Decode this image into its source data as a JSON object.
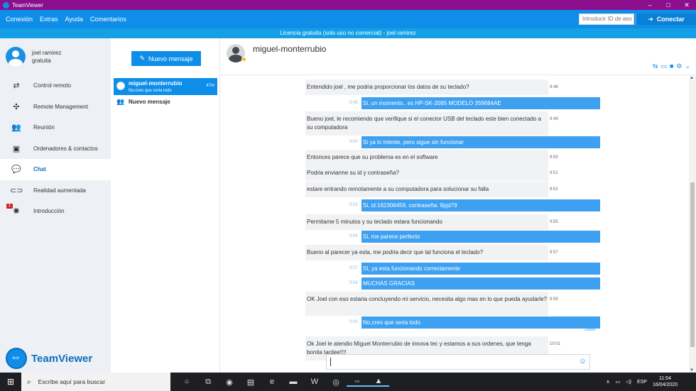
{
  "window": {
    "title": "TeamViewer"
  },
  "menu": [
    "Conexión",
    "Extras",
    "Ayuda",
    "Comentarios"
  ],
  "topbar": {
    "id_placeholder": "Introducir ID de aso",
    "connect_label": "Conectar"
  },
  "license": "Licencia gratuita (solo uso no comercial) - joel ramirez",
  "profile": {
    "name": "joel ramirez",
    "plan": "gratuita"
  },
  "nav": [
    {
      "label": "Control remoto",
      "icon": "arrows-icon"
    },
    {
      "label": "Remote Management",
      "icon": "crosshair-icon"
    },
    {
      "label": "Reunión",
      "icon": "people-icon"
    },
    {
      "label": "Ordenadores & contactos",
      "icon": "contacts-icon"
    },
    {
      "label": "Chat",
      "icon": "chat-icon",
      "active": true
    },
    {
      "label": "Realidad aumentada",
      "icon": "ar-glasses-icon"
    },
    {
      "label": "Introducción",
      "icon": "lightbulb-icon",
      "badge": "1"
    }
  ],
  "brand": "TeamViewer",
  "conversations": {
    "new_message_button": "Nuevo mensaje",
    "active": {
      "name": "miguel-monterrubio",
      "preview": "No,creo que seria todo",
      "time": "47m"
    },
    "new_entry": "Nuevo mensaje"
  },
  "chat": {
    "contact": "miguel-monterrubio",
    "read_label": "Leído",
    "messages": [
      {
        "dir": "in",
        "text": "Entendido joel , me podria proporcionar los datos de su teclado?",
        "time": "9:46"
      },
      {
        "dir": "out",
        "text": "Si, un momento.. es HP-SK-2085 MODELO 359684AE",
        "time": "9:48"
      },
      {
        "dir": "in",
        "text": "Bueno joel, le recomiendo que verifique si el conector USB del teclado este bien conectado a su computadora",
        "time": "9:49"
      },
      {
        "dir": "out",
        "text": "Si ya lo intente, pero sigue sin funcionar",
        "time": "9:50"
      },
      {
        "dir": "in",
        "text": "Entonces parece que su problema es en el software",
        "time": "9:50"
      },
      {
        "dir": "in",
        "text": "Podria enviarme su id y contraseña?",
        "time": "9:51"
      },
      {
        "dir": "in",
        "text": "estare entrando remotamente a su computadora para solucionar su falla",
        "time": "9:52"
      },
      {
        "dir": "out",
        "text": "Si, id:162306459, contraseña: 9pjd79",
        "time": "9:53"
      },
      {
        "dir": "in",
        "text": "Permitame 5 minutos y su teclado estara funcionando",
        "time": "9:55"
      },
      {
        "dir": "out",
        "text": "Si, me parece perfecto",
        "time": "9:56"
      },
      {
        "dir": "in",
        "text": "Bueno al parecer ya esta, me podria decir que tal funciona el teclado?",
        "time": "9:57"
      },
      {
        "dir": "out",
        "text": "SI, ya esta funcionando correctamente",
        "time": "9:57"
      },
      {
        "dir": "out",
        "text": "MUCHAS GRACIAS",
        "time": "9:58"
      },
      {
        "dir": "in",
        "text": "OK Joel con eso estaria concluyendo mi servicio, necesita algo mas en lo que pueda ayudarle?",
        "time": "9:59"
      },
      {
        "dir": "out",
        "text": "No,creo que seria todo",
        "time": "9:59"
      },
      {
        "dir": "in",
        "text": "Ok Joel le atendio Miguel Monterrubio de innova tec y estamos a sus ordenes, que tenga bonita tardee!!!!",
        "time": "10:01"
      }
    ]
  },
  "taskbar": {
    "search_placeholder": "Escribe aquí para buscar",
    "lang": "ESP",
    "time": "11:54",
    "date": "16/04/2020"
  }
}
